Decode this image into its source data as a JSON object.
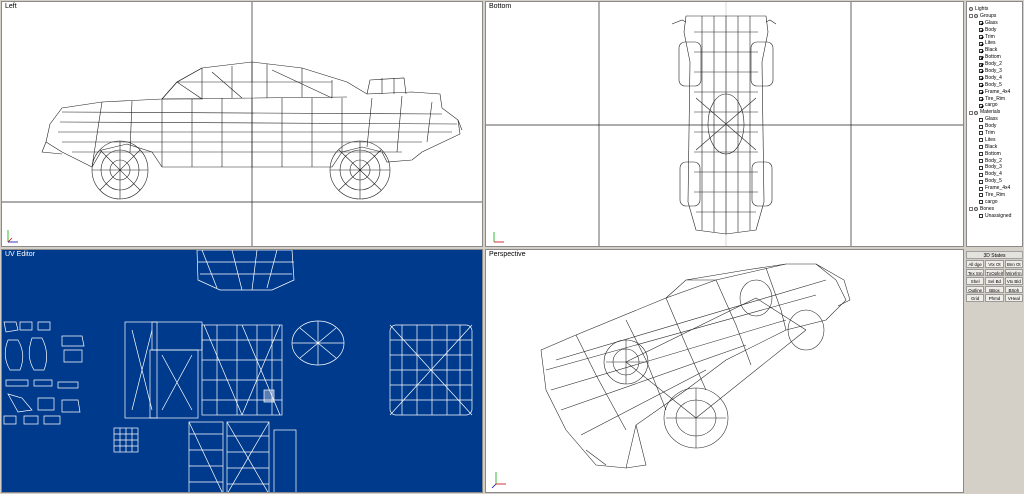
{
  "viewports": {
    "left": {
      "label": "Left"
    },
    "bottom": {
      "label": "Bottom"
    },
    "uv": {
      "label": "UV Editor"
    },
    "perspective": {
      "label": "Perspective"
    }
  },
  "colors": {
    "uv_background": "#003a8c",
    "panel": "#d4d0c8",
    "wire": "#1a1a1a"
  },
  "axis_icons": [
    "axis-gizmo-icon"
  ],
  "tree": {
    "lights": "Lights",
    "groups": {
      "label": "Groups",
      "items": [
        "Glass",
        "Body",
        "Trim",
        "Lites",
        "Black",
        "Bottom",
        "Body_2",
        "Body_3",
        "Body_4",
        "Body_5",
        "Frame_4x4",
        "Tire_Rim",
        "cargo"
      ]
    },
    "materials": {
      "label": "Materials",
      "items": [
        "Glass",
        "Body",
        "Trim",
        "Lites",
        "Black",
        "Bottom",
        "Body_2",
        "Body_3",
        "Body_4",
        "Body_5",
        "Frame_4x4",
        "Tire_Rim",
        "cargo"
      ]
    },
    "bones": {
      "label": "Bones",
      "items": [
        "Unassigned"
      ]
    }
  },
  "states": {
    "title": "3D States",
    "buttons": [
      "All dge",
      "Vtx Ot",
      "Bnn Ot",
      "Tex Sm",
      "TxOpfe(t",
      "Wirefrm",
      "Shel",
      "Sel Bd",
      "Vtx Bld",
      "Outline",
      "BBox",
      "BSph",
      "Grid",
      "Phmd",
      "VHeal"
    ]
  }
}
